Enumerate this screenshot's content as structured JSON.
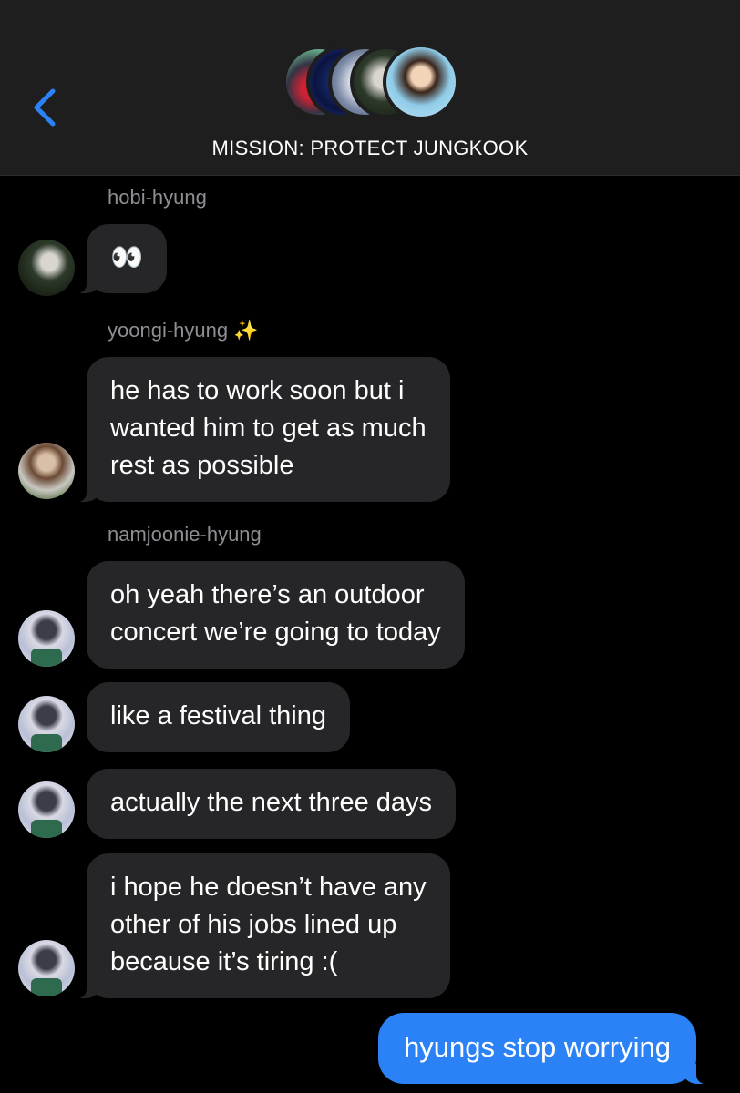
{
  "header": {
    "title": "MISSION: PROTECT JUNGKOOK",
    "back_icon": "chevron-left-icon",
    "accent_color": "#2b82f6"
  },
  "messages": [
    {
      "sender": "hobi-hyung",
      "lines": [
        "👀"
      ]
    },
    {
      "sender": "yoongi-hyung ✨",
      "lines": [
        "he has to work soon but i",
        "wanted him to get as much",
        "rest as possible"
      ]
    },
    {
      "sender": "namjoonie-hyung",
      "lines": [
        "oh yeah there’s an outdoor",
        "concert we’re going to today"
      ]
    },
    {
      "lines": [
        "like a festival thing"
      ]
    },
    {
      "lines": [
        "actually the next three days"
      ]
    },
    {
      "lines": [
        "i hope he doesn’t have any",
        "other of his jobs lined up",
        "because it’s tiring :("
      ]
    }
  ],
  "outgoing": {
    "text": "hyungs stop worrying"
  }
}
